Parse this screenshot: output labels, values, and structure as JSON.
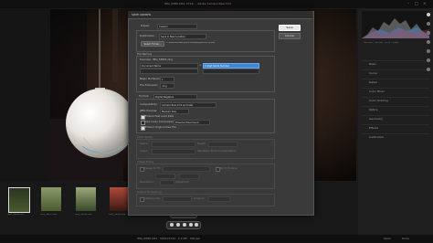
{
  "window": {
    "title": "IMG_5686.CR2, 5716 ... Adobe Camera Raw 13.0",
    "status": "IMG_5686.CR2 · 5616x3744 · 2.0 MP  ·  300 ppi"
  },
  "dialog": {
    "title": "Save Options",
    "preset_label": "Preset:",
    "preset_value": "Custom",
    "destination_label": "Destination:",
    "destination_value": "Save in New Location",
    "select_folder_label": "Select Folder...",
    "folder_path": "C:\\Users\\Desktop\\Pictures\\Lightroom\\Edits",
    "file_naming_header": "File Naming",
    "example_label": "Example:",
    "example_value": "IMG_5686b.dng",
    "name_field_1": "Document Name",
    "name_field_2": "1 Digit Serial Number",
    "begin_numbering_label": "Begin Numbering:",
    "begin_numbering_value": "1",
    "file_extension_label": "File Extension:",
    "file_extension_value": ".dng",
    "format_label": "Format:",
    "format_value": "Digital Negative",
    "compatibility_label": "Compatibility:",
    "compatibility_value": "Camera Raw 13.0 and later",
    "jpeg_preview_label": "JPEG Preview:",
    "jpeg_preview_value": "Medium Size",
    "embed_fast_load_label": "Embed Fast Load Data",
    "embed_fast_load": true,
    "lossy_label": "Use Lossy Compression:",
    "lossy_value": "Preserve Pixel Count",
    "lossy": false,
    "embed_original_label": "Embed Original Raw File",
    "embed_original": true,
    "color_space_header": "Color Space",
    "space_label": "Space:",
    "intent_label": "Intent:",
    "depth_label": "Depth:",
    "black_point_label": "Use Black Point Compensation",
    "image_sizing_header": "Image Sizing",
    "resize_to_fit_label": "Resize to Fit:",
    "dont_enlarge_label": "Don't Enlarge",
    "resolution_label": "Resolution:",
    "resolution_unit": "pixels/inch",
    "output_sharpening_header": "Output Sharpening",
    "sharpen_label": "Sharpen For:",
    "amount_label": "Amount:",
    "save_button": "Save",
    "cancel_button": "Cancel"
  },
  "sidebar": {
    "panels": [
      "Basic",
      "Curve",
      "Detail",
      "Color Mixer",
      "Color Grading",
      "Optics",
      "Geometry",
      "Effects",
      "Calibration"
    ],
    "icons": [
      "edit-icon",
      "crop-icon",
      "heal-icon",
      "mask-icon",
      "redeye-icon",
      "preset-icon",
      "more-icon"
    ]
  },
  "filmstrip": {
    "items": [
      {
        "name": "IMG_5686.CR2",
        "color": "#3b4a2a"
      },
      {
        "name": "IMG_5687.CR2",
        "color": "#6a7a4a"
      },
      {
        "name": "IMG_5688.CR2",
        "color": "#5d7040"
      },
      {
        "name": "IMG_5689.CR2",
        "color": "#7a3a2a"
      }
    ]
  },
  "colors": {
    "accent": "#3f86d6",
    "dialog_bg": "#3a3a3a",
    "app_bg": "#1a1a1a"
  }
}
